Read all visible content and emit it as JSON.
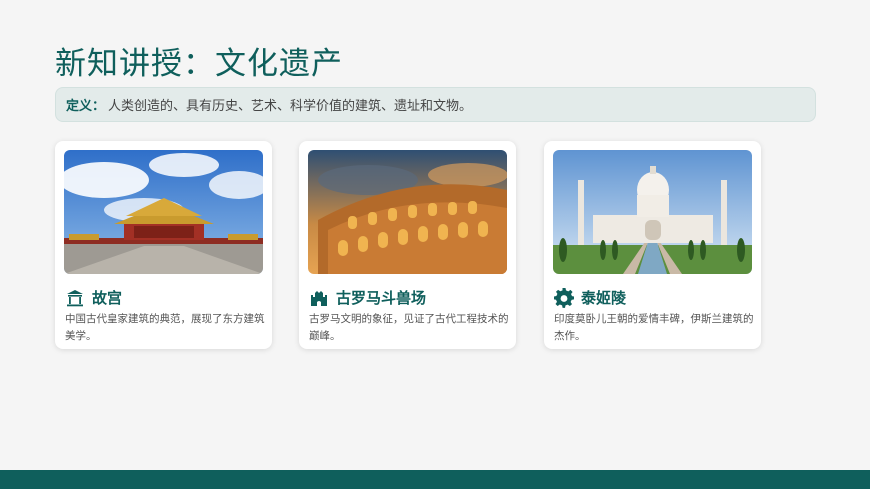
{
  "page": {
    "title": "新知讲授：文化遗产",
    "definition_label": "定义：",
    "definition_text": "人类创造的、具有历史、艺术、科学价值的建筑、遗址和文物。"
  },
  "cards": [
    {
      "name": "故宫",
      "description": "中国古代皇家建筑的典范，展现了东方建筑美学。",
      "icon": "temple-icon"
    },
    {
      "name": "古罗马斗兽场",
      "description": "古罗马文明的象征，见证了古代工程技术的巅峰。",
      "icon": "castle-icon"
    },
    {
      "name": "泰姬陵",
      "description": "印度莫卧儿王朝的爱情丰碑，伊斯兰建筑的杰作。",
      "icon": "gear-icon"
    }
  ],
  "colors": {
    "accent": "#0f5f5c",
    "background": "#f5f5f5",
    "definition_bg": "#e3ebea"
  }
}
